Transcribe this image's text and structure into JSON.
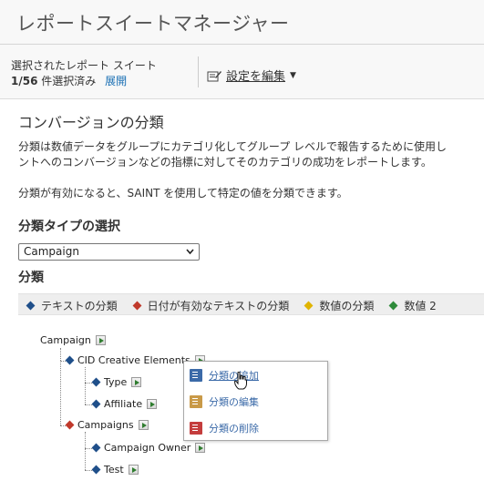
{
  "app": {
    "title": "レポートスイートマネージャー"
  },
  "selection": {
    "label": "選択されたレポート スイート",
    "count": "1/56",
    "count_suffix": "件選択済み",
    "expand_link": "展開"
  },
  "toolbar": {
    "edit_settings": "設定を編集"
  },
  "page": {
    "title": "コンバージョンの分類",
    "desc_line1": "分類は数値データをグループにカテゴリ化してグループ レベルで報告するために使用し",
    "desc_line2": "ントへのコンバージョンなどの指標に対してそのカテゴリの成功をレポートします。",
    "desc_line3": "分類が有効になると、SAINT を使用して特定の値を分類できます。",
    "type_heading": "分類タイプの選択",
    "type_select_value": "Campaign",
    "classifications_heading": "分類"
  },
  "legend": [
    {
      "label": "テキストの分類",
      "color": "#1f4f8a"
    },
    {
      "label": "日付が有効なテキストの分類",
      "color": "#c0392b"
    },
    {
      "label": "数値の分類",
      "color": "#e0b400"
    },
    {
      "label": "数値 2",
      "color": "#2e8b3a"
    }
  ],
  "tree": {
    "root": "Campaign",
    "cid": "CID Creative Elements",
    "type": "Type",
    "affiliate": "Affiliate",
    "campaigns": "Campaigns",
    "campaign_owner": "Campaign Owner",
    "test": "Test"
  },
  "context_menu": {
    "add": "分類の追加",
    "edit": "分類の編集",
    "delete": "分類の削除"
  }
}
